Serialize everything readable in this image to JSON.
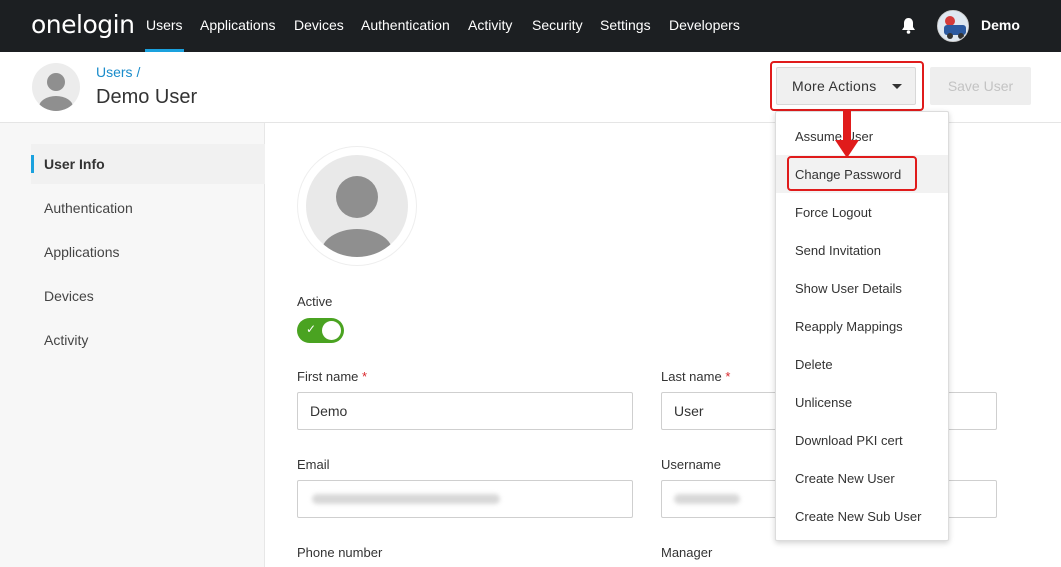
{
  "topnav": {
    "logo": "onelogin",
    "items": [
      {
        "label": "Users"
      },
      {
        "label": "Applications"
      },
      {
        "label": "Devices"
      },
      {
        "label": "Authentication"
      },
      {
        "label": "Activity"
      },
      {
        "label": "Security"
      },
      {
        "label": "Settings"
      },
      {
        "label": "Developers"
      }
    ],
    "active": "Users",
    "user_name": "Demo",
    "accent_color": "#1aa1de"
  },
  "header": {
    "breadcrumb": "Users",
    "breadcrumb_sep": "/",
    "title": "Demo User",
    "more_actions_label": "More Actions",
    "save_label": "Save User"
  },
  "sidebar": {
    "items": [
      {
        "label": "User Info"
      },
      {
        "label": "Authentication"
      },
      {
        "label": "Applications"
      },
      {
        "label": "Devices"
      },
      {
        "label": "Activity"
      }
    ],
    "active": "User Info"
  },
  "form": {
    "active_label": "Active",
    "active_value": true,
    "first_name_label": "First name",
    "first_name_value": "Demo",
    "last_name_label": "Last name",
    "last_name_value": "User",
    "required_mark": "*",
    "email_label": "Email",
    "username_label": "Username",
    "phone_label": "Phone number",
    "manager_label": "Manager",
    "toggle_color": "#4aa321"
  },
  "dropdown": {
    "items": [
      {
        "label": "Assume User"
      },
      {
        "label": "Change Password"
      },
      {
        "label": "Force Logout"
      },
      {
        "label": "Send Invitation"
      },
      {
        "label": "Show User Details"
      },
      {
        "label": "Reapply Mappings"
      },
      {
        "label": "Delete"
      },
      {
        "label": "Unlicense"
      },
      {
        "label": "Download PKI cert"
      },
      {
        "label": "Create New User"
      },
      {
        "label": "Create New Sub User"
      }
    ],
    "highlighted": "Change Password",
    "annotation_color": "#e01b1b"
  }
}
